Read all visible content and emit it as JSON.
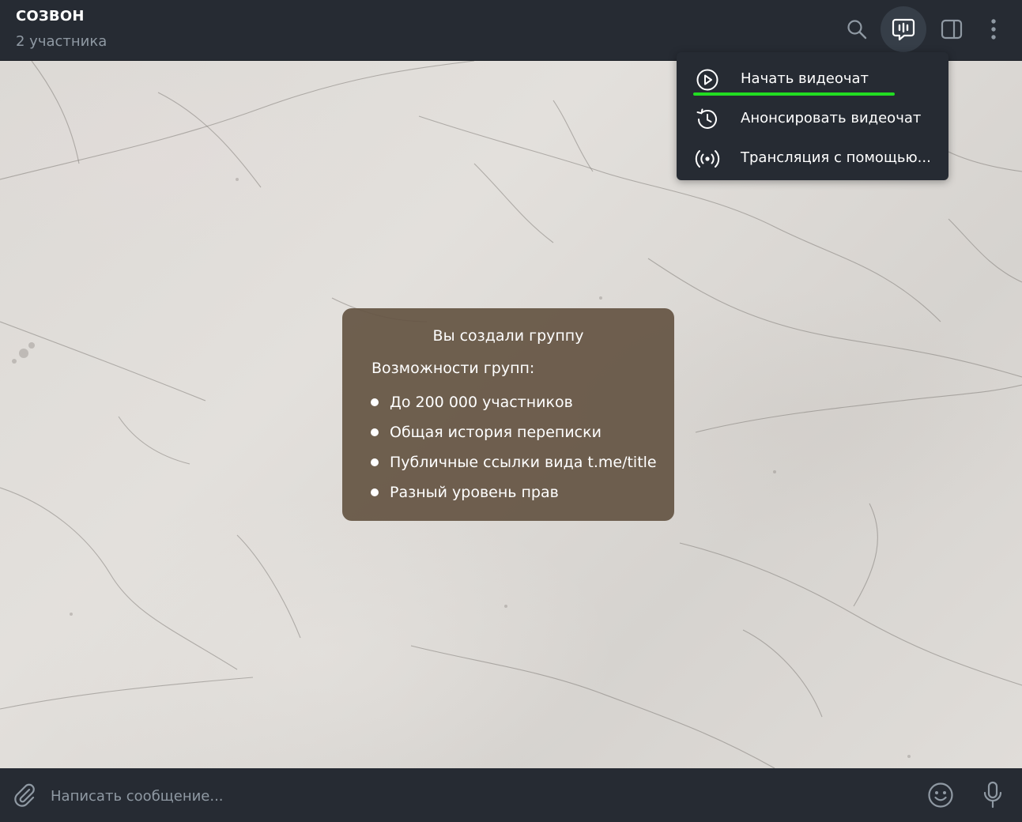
{
  "header": {
    "title": "СОЗВОН",
    "subtitle": "2 участника",
    "icons": [
      "search-icon",
      "voice-chat-icon",
      "sidebar-toggle-icon",
      "more-vertical-icon"
    ]
  },
  "menu": {
    "items": [
      {
        "label": "Начать видеочат",
        "icon": "play-circle-icon"
      },
      {
        "label": "Анонсировать видеочат",
        "icon": "history-icon"
      },
      {
        "label": "Трансляция с помощью...",
        "icon": "broadcast-icon"
      }
    ],
    "highlight_color": "#22dd22"
  },
  "service_message": {
    "title": "Вы создали группу",
    "subtitle": "Возможности групп:",
    "features": [
      "До 200 000 участников",
      "Общая история переписки",
      "Публичные ссылки вида t.me/title",
      "Разный уровень прав"
    ]
  },
  "composer": {
    "placeholder": "Написать сообщение...",
    "icons": [
      "attach-icon",
      "emoji-icon",
      "microphone-icon"
    ]
  },
  "colors": {
    "panel_bg": "#262b33",
    "muted_text": "#8f99a3",
    "service_bg": "#645442"
  }
}
